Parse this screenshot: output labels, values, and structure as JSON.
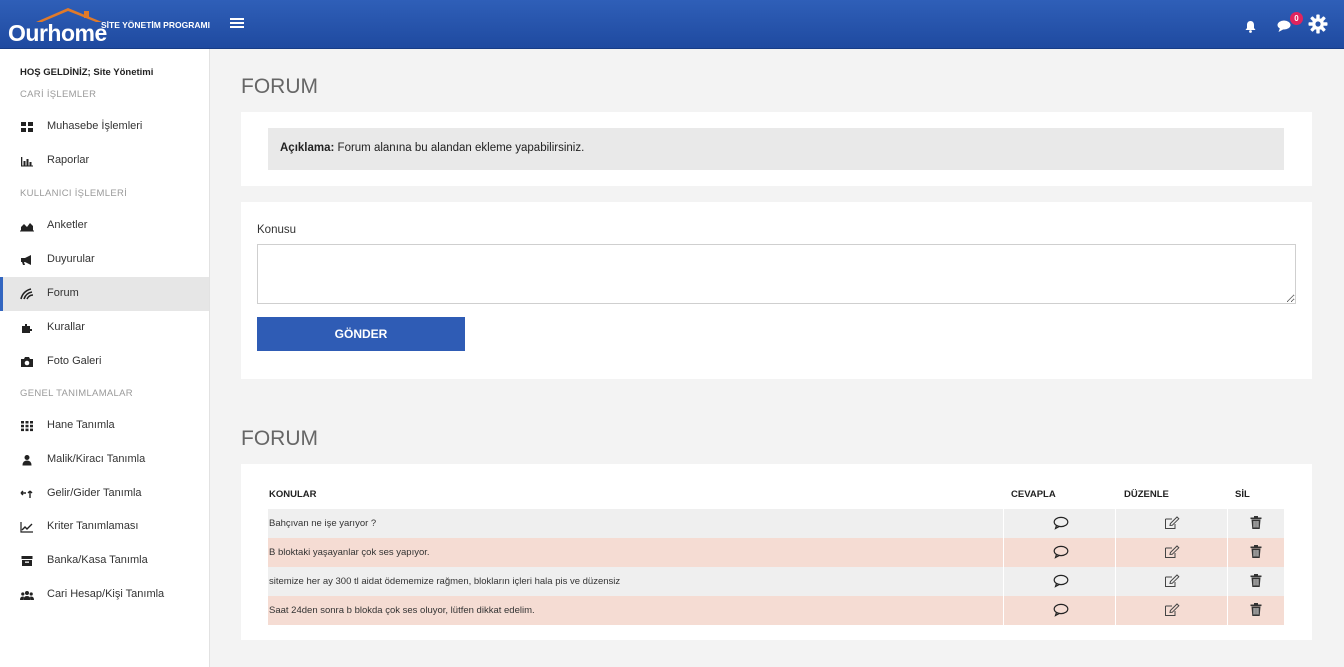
{
  "topbar": {
    "logo_main": "Ourhome",
    "logo_sub": "SİTE YÖNETİM PROGRAMI",
    "messages_badge": "0"
  },
  "sidebar": {
    "welcome": "HOŞ GELDİNİZ; Site Yönetimi",
    "sections": [
      "CARİ İŞLEMLER",
      "KULLANICI İŞLEMLERİ",
      "GENEL TANIMLAMALAR"
    ],
    "items": [
      {
        "label": "Muhasebe İşlemleri",
        "icon": "dashboard-icon"
      },
      {
        "label": "Raporlar",
        "icon": "bar-chart-icon"
      },
      {
        "label": "Anketler",
        "icon": "area-chart-icon"
      },
      {
        "label": "Duyurular",
        "icon": "megaphone-icon"
      },
      {
        "label": "Forum",
        "icon": "forum-icon"
      },
      {
        "label": "Kurallar",
        "icon": "puzzle-icon"
      },
      {
        "label": "Foto Galeri",
        "icon": "camera-icon"
      },
      {
        "label": "Hane Tanımla",
        "icon": "grid-icon"
      },
      {
        "label": "Malik/Kiracı Tanımla",
        "icon": "user-icon"
      },
      {
        "label": "Gelir/Gider Tanımla",
        "icon": "exchange-icon"
      },
      {
        "label": "Kriter Tanımlaması",
        "icon": "line-chart-icon"
      },
      {
        "label": "Banka/Kasa Tanımla",
        "icon": "archive-icon"
      },
      {
        "label": "Cari Hesap/Kişi Tanımla",
        "icon": "users-icon"
      }
    ],
    "active_item": "Forum"
  },
  "main": {
    "title1": "FORUM",
    "info_label": "Açıklama:",
    "info_text": " Forum alanına bu alandan ekleme yapabilirsiniz.",
    "subject_label": "Konusu",
    "subject_value": "",
    "submit_label": "GÖNDER",
    "title2": "FORUM",
    "table": {
      "headers": [
        "KONULAR",
        "CEVAPLA",
        "DÜZENLE",
        "SİL"
      ],
      "rows": [
        {
          "topic": "Bahçıvan ne işe yarıyor ?",
          "bg": "#efefef"
        },
        {
          "topic": "B bloktaki yaşayanlar çok ses yapıyor.",
          "bg": "#f5dcd3"
        },
        {
          "topic": "sitemize her ay 300 tl aidat ödememize rağmen, blokların içleri hala pis ve düzensiz",
          "bg": "#efefef"
        },
        {
          "topic": "Saat 24den sonra b blokda çok ses oluyor, lütfen dikkat edelim.",
          "bg": "#f5dcd3"
        }
      ]
    }
  },
  "colors": {
    "primary": "#2f5cb5",
    "row_alt": "#f5dcd3",
    "row": "#efefef",
    "badge": "#e0245e"
  }
}
